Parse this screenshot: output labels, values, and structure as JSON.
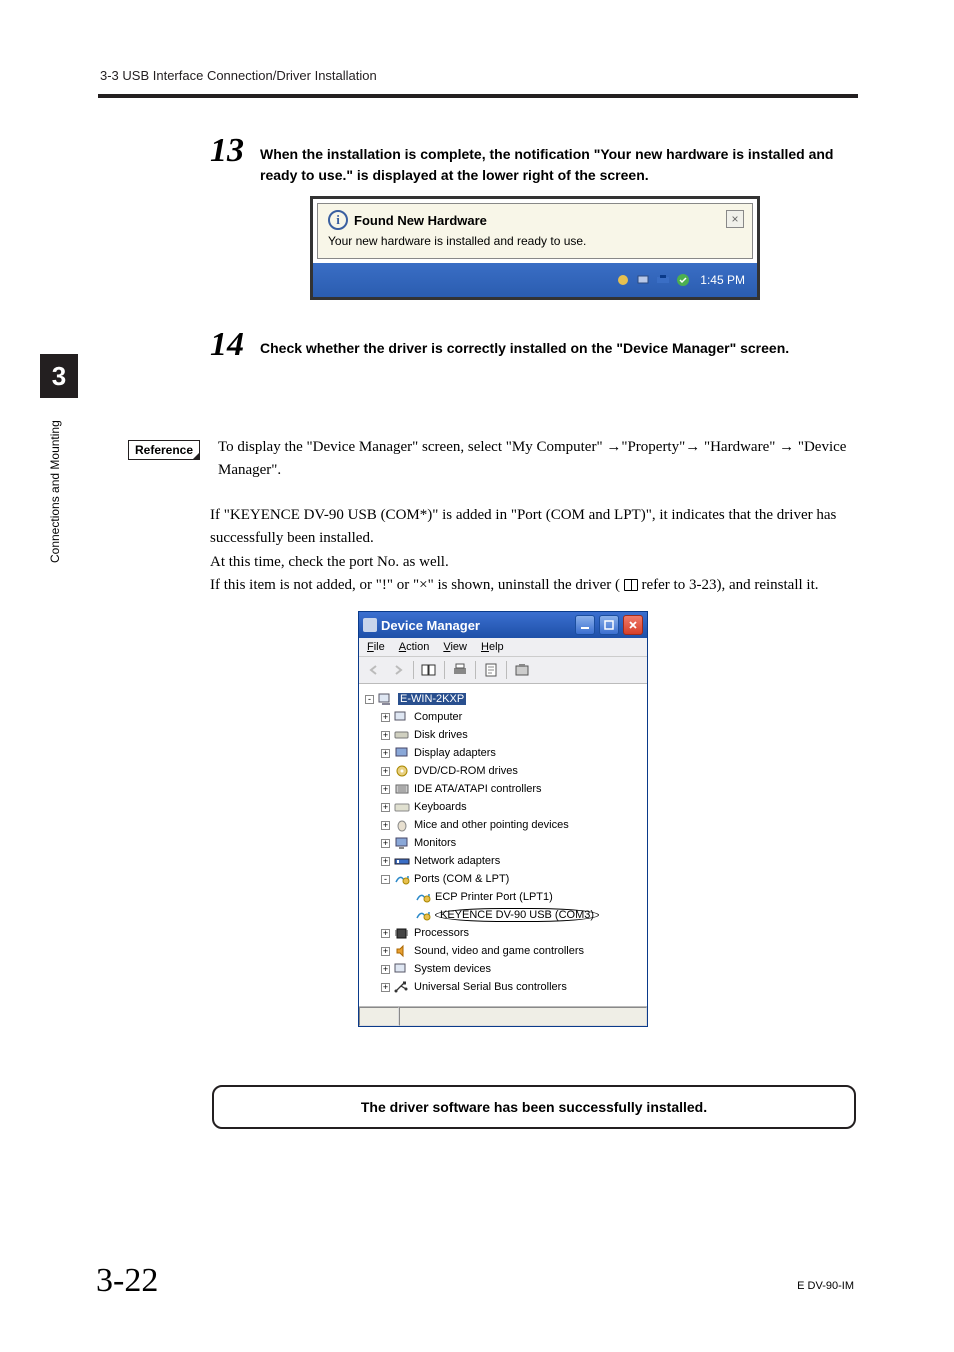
{
  "header": {
    "section": "3-3  USB Interface Connection/Driver Installation"
  },
  "side": {
    "chapter": "3",
    "label": "Connections and Mounting"
  },
  "steps": {
    "s13": {
      "num": "13",
      "text": "When the installation is complete, the notification \"Your new hardware is installed and ready to use.\" is displayed at the lower right of the screen."
    },
    "s14": {
      "num": "14",
      "text": "Check whether the driver is correctly installed on the \"Device Manager\" screen."
    }
  },
  "balloon": {
    "title": "Found New Hardware",
    "sub": "Your new hardware is installed and ready to use.",
    "time": "1:45 PM"
  },
  "reference": {
    "label": "Reference",
    "text": "To display the \"Device Manager\" screen, select \"My Computer\" →\"Property\"→ \"Hardware\" → \"Device Manager\"."
  },
  "para1": "If \"KEYENCE DV-90 USB (COM*)\" is added in \"Port (COM and LPT)\", it indicates that the driver has successfully been installed.",
  "para2": "At this time, check the port No. as well.",
  "para3a": "If this item is not added, or \"!\" or \"×\" is shown, uninstall the driver ( ",
  "para3b": " refer to 3-23), and reinstall it.",
  "dm": {
    "title": "Device Manager",
    "menu": {
      "file": "File",
      "action": "Action",
      "view": "View",
      "help": "Help"
    },
    "root": "E-WIN-2KXP",
    "nodes": {
      "computer": "Computer",
      "disk": "Disk drives",
      "display": "Display adapters",
      "dvd": "DVD/CD-ROM drives",
      "ide": "IDE ATA/ATAPI controllers",
      "keyboards": "Keyboards",
      "mice": "Mice and other pointing devices",
      "monitors": "Monitors",
      "network": "Network adapters",
      "ports": "Ports (COM & LPT)",
      "ecp": "ECP Printer Port (LPT1)",
      "keyence": "KEYENCE DV-90 USB (COM3)",
      "processors": "Processors",
      "sound": "Sound, video and game controllers",
      "system": "System devices",
      "usb": "Universal Serial Bus controllers"
    }
  },
  "success": "The driver software has been successfully installed.",
  "footer": {
    "page": "3-22",
    "code": "E DV-90-IM"
  }
}
